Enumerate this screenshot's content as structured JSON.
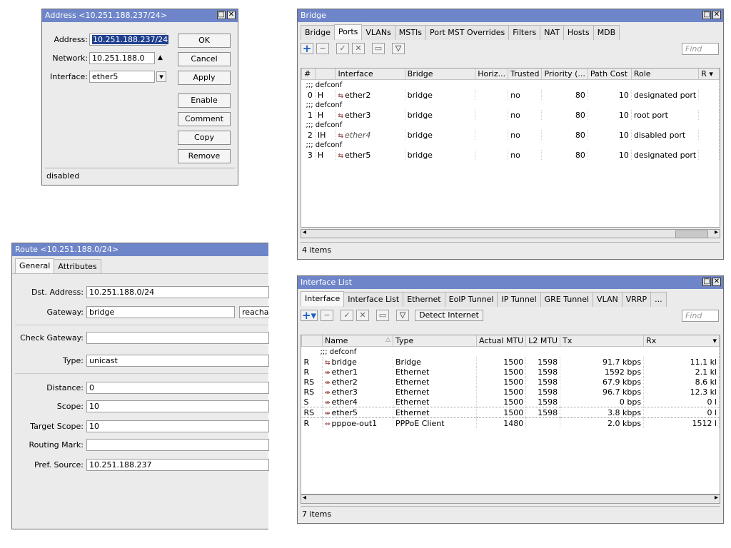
{
  "address_dialog": {
    "title": "Address <10.251.188.237/24>",
    "address_label": "Address:",
    "address_value": "10.251.188.237/24",
    "network_label": "Network:",
    "network_value": "10.251.188.0",
    "interface_label": "Interface:",
    "interface_value": "ether5",
    "buttons": [
      "OK",
      "Cancel",
      "Apply",
      "Enable",
      "Comment",
      "Copy",
      "Remove"
    ],
    "status": "disabled"
  },
  "route_dialog": {
    "title": "Route <10.251.188.0/24>",
    "tabs": [
      "General",
      "Attributes"
    ],
    "fields": [
      {
        "label": "Dst. Address:",
        "value": "10.251.188.0/24"
      },
      {
        "label": "Gateway:",
        "value": "bridge",
        "extra": "reacha"
      },
      {
        "label": "Check Gateway:",
        "value": ""
      },
      {
        "label": "Type:",
        "value": "unicast"
      },
      {
        "label": "Distance:",
        "value": "0"
      },
      {
        "label": "Scope:",
        "value": "10"
      },
      {
        "label": "Target Scope:",
        "value": "10"
      },
      {
        "label": "Routing Mark:",
        "value": ""
      },
      {
        "label": "Pref. Source:",
        "value": "10.251.188.237"
      }
    ]
  },
  "bridge_window": {
    "title": "Bridge",
    "tabs": [
      "Bridge",
      "Ports",
      "VLANs",
      "MSTIs",
      "Port MST Overrides",
      "Filters",
      "NAT",
      "Hosts",
      "MDB"
    ],
    "active_tab": "Ports",
    "find_placeholder": "Find",
    "columns": [
      "#",
      "",
      "Interface",
      "Bridge",
      "Horiz...",
      "Trusted",
      "Priority (...",
      "Path Cost",
      "Role",
      "R"
    ],
    "comment": ";;; defconf",
    "rows": [
      {
        "num": "0",
        "flag": "H",
        "iface": "ether2",
        "bridge": "bridge",
        "horiz": "",
        "trusted": "no",
        "priority": "80",
        "cost": "10",
        "role": "designated port"
      },
      {
        "num": "1",
        "flag": "H",
        "iface": "ether3",
        "bridge": "bridge",
        "horiz": "",
        "trusted": "no",
        "priority": "80",
        "cost": "10",
        "role": "root port"
      },
      {
        "num": "2",
        "flag": "IH",
        "iface": "ether4",
        "bridge": "bridge",
        "horiz": "",
        "trusted": "no",
        "priority": "80",
        "cost": "10",
        "role": "disabled port"
      },
      {
        "num": "3",
        "flag": "H",
        "iface": "ether5",
        "bridge": "bridge",
        "horiz": "",
        "trusted": "no",
        "priority": "80",
        "cost": "10",
        "role": "designated port"
      }
    ],
    "status": "4 items"
  },
  "interface_window": {
    "title": "Interface List",
    "tabs": [
      "Interface",
      "Interface List",
      "Ethernet",
      "EoIP Tunnel",
      "IP Tunnel",
      "GRE Tunnel",
      "VLAN",
      "VRRP",
      "..."
    ],
    "active_tab": "Interface",
    "detect_button": "Detect Internet",
    "find_placeholder": "Find",
    "columns": [
      "",
      "Name",
      "Type",
      "Actual MTU",
      "L2 MTU",
      "Tx",
      "Rx"
    ],
    "comment": ";;; defconf",
    "rows": [
      {
        "flag": "R",
        "name": "bridge",
        "type": "Bridge",
        "mtu": "1500",
        "l2mtu": "1598",
        "tx": "91.7 kbps",
        "rx": "11.1 kl"
      },
      {
        "flag": "R",
        "name": "ether1",
        "type": "Ethernet",
        "mtu": "1500",
        "l2mtu": "1598",
        "tx": "1592 bps",
        "rx": "2.1 kl"
      },
      {
        "flag": "RS",
        "name": "ether2",
        "type": "Ethernet",
        "mtu": "1500",
        "l2mtu": "1598",
        "tx": "67.9 kbps",
        "rx": "8.6 kl"
      },
      {
        "flag": "RS",
        "name": "ether3",
        "type": "Ethernet",
        "mtu": "1500",
        "l2mtu": "1598",
        "tx": "96.7 kbps",
        "rx": "12.3 kl"
      },
      {
        "flag": "S",
        "name": "ether4",
        "type": "Ethernet",
        "mtu": "1500",
        "l2mtu": "1598",
        "tx": "0 bps",
        "rx": "0 l"
      },
      {
        "flag": "RS",
        "name": "ether5",
        "type": "Ethernet",
        "mtu": "1500",
        "l2mtu": "1598",
        "tx": "3.8 kbps",
        "rx": "0 l"
      },
      {
        "flag": "R",
        "name": "pppoe-out1",
        "type": "PPPoE Client",
        "mtu": "1480",
        "l2mtu": "",
        "tx": "2.0 kbps",
        "rx": "1512 l"
      }
    ],
    "status": "7 items"
  }
}
